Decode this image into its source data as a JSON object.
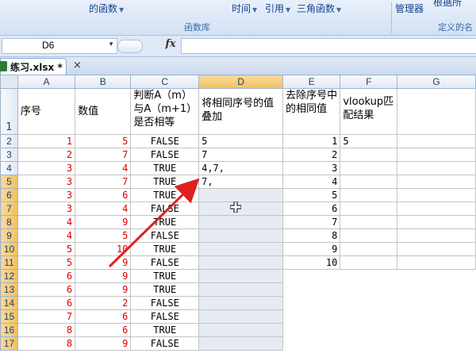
{
  "ribbon": {
    "items": [
      "的函数",
      "时间",
      "引用",
      "三角函数",
      "管理器",
      "根据所"
    ],
    "groups": [
      "函数库",
      "定义的名"
    ]
  },
  "formula_bar": {
    "name_box": "D6",
    "fx_label": "fx",
    "formula": ""
  },
  "workbook_tab": {
    "name": "练习.xlsx *",
    "close": "×"
  },
  "columns": [
    "A",
    "B",
    "C",
    "D",
    "E",
    "F",
    "G"
  ],
  "headers": {
    "A": "序号",
    "B": "数值",
    "C": "判断A（m）与A（m+1）是否相等",
    "D": "将相同序号的值叠加",
    "E": "去除序号中的相同值",
    "F": "vlookup匹配结果",
    "G": ""
  },
  "rows": [
    {
      "r": "2",
      "a": "1",
      "b": "5",
      "c": "FALSE",
      "d": "5",
      "e": "1",
      "f": "5"
    },
    {
      "r": "3",
      "a": "2",
      "b": "7",
      "c": "FALSE",
      "d": "7",
      "e": "2",
      "f": ""
    },
    {
      "r": "4",
      "a": "3",
      "b": "4",
      "c": "TRUE",
      "d": "4,7,",
      "e": "3",
      "f": ""
    },
    {
      "r": "5",
      "a": "3",
      "b": "7",
      "c": "TRUE",
      "d": "7,",
      "e": "4",
      "f": ""
    },
    {
      "r": "6",
      "a": "3",
      "b": "6",
      "c": "TRUE",
      "d": "",
      "e": "5",
      "f": ""
    },
    {
      "r": "7",
      "a": "3",
      "b": "4",
      "c": "FALSE",
      "d": "",
      "e": "6",
      "f": ""
    },
    {
      "r": "8",
      "a": "4",
      "b": "9",
      "c": "TRUE",
      "d": "",
      "e": "7",
      "f": ""
    },
    {
      "r": "9",
      "a": "4",
      "b": "5",
      "c": "FALSE",
      "d": "",
      "e": "8",
      "f": ""
    },
    {
      "r": "10",
      "a": "5",
      "b": "10",
      "c": "TRUE",
      "d": "",
      "e": "9",
      "f": ""
    },
    {
      "r": "11",
      "a": "5",
      "b": "9",
      "c": "FALSE",
      "d": "",
      "e": "10",
      "f": ""
    },
    {
      "r": "12",
      "a": "6",
      "b": "9",
      "c": "TRUE",
      "d": "",
      "e": "",
      "f": ""
    },
    {
      "r": "13",
      "a": "6",
      "b": "9",
      "c": "TRUE",
      "d": "",
      "e": "",
      "f": ""
    },
    {
      "r": "14",
      "a": "6",
      "b": "2",
      "c": "FALSE",
      "d": "",
      "e": "",
      "f": ""
    },
    {
      "r": "15",
      "a": "7",
      "b": "6",
      "c": "FALSE",
      "d": "",
      "e": "",
      "f": ""
    },
    {
      "r": "16",
      "a": "8",
      "b": "6",
      "c": "TRUE",
      "d": "",
      "e": "",
      "f": ""
    },
    {
      "r": "17",
      "a": "8",
      "b": "9",
      "c": "FALSE",
      "d": "",
      "e": "",
      "f": ""
    }
  ],
  "header_row_number": "1",
  "selected_cell": "D6",
  "colors": {
    "value_red": "#e00000",
    "arrow_red": "#e02020",
    "header_sel": "#f1c15f"
  }
}
